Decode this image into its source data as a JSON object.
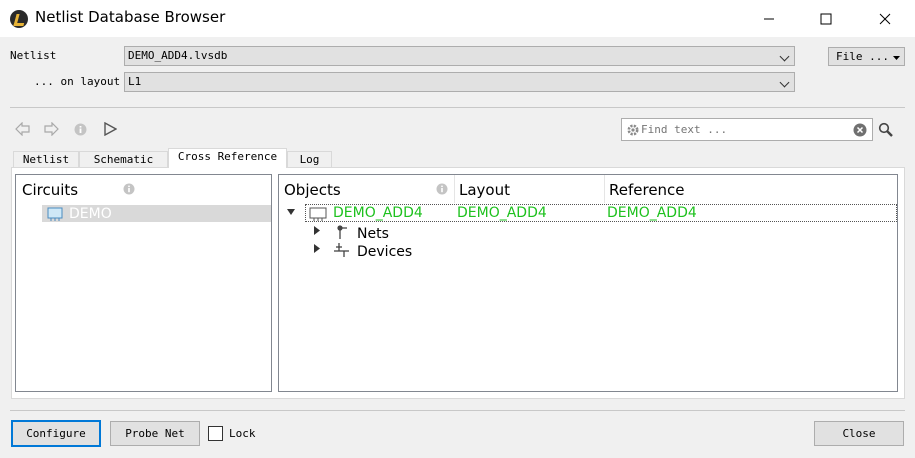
{
  "window": {
    "title": "Netlist Database Browser"
  },
  "form": {
    "netlist_label": "Netlist",
    "netlist_value": "DEMO_ADD4.lvsdb",
    "layout_label": "... on layout",
    "layout_value": "L1",
    "file_button": "File ..."
  },
  "search": {
    "placeholder": "Find text ..."
  },
  "tabs": [
    {
      "label": "Netlist"
    },
    {
      "label": "Schematic"
    },
    {
      "label": "Cross Reference"
    },
    {
      "label": "Log"
    }
  ],
  "circuits": {
    "header": "Circuits",
    "items": [
      {
        "label": "DEMO"
      }
    ]
  },
  "objects": {
    "columns": [
      "Objects",
      "Layout",
      "Reference"
    ],
    "root": {
      "object": "DEMO_ADD4",
      "layout": "DEMO_ADD4",
      "reference": "DEMO_ADD4"
    },
    "children": [
      {
        "label": "Nets"
      },
      {
        "label": "Devices"
      }
    ]
  },
  "bottom": {
    "configure": "Configure",
    "probe_net": "Probe Net",
    "lock": "Lock",
    "close": "Close"
  },
  "colors": {
    "match_green": "#1ec11e",
    "selection": "#d9d9d9",
    "focus": "#0078d7"
  }
}
